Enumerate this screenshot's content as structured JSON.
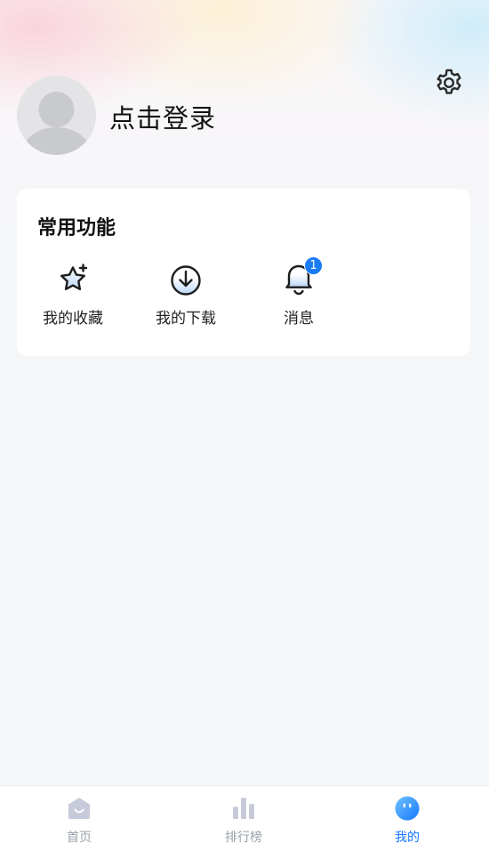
{
  "header": {
    "login_text": "点击登录",
    "settings_icon": "gear-icon",
    "avatar_icon": "default-avatar-icon"
  },
  "functions_card": {
    "title": "常用功能",
    "items": [
      {
        "label": "我的收藏",
        "icon": "star-sparkle-icon"
      },
      {
        "label": "我的下载",
        "icon": "download-circle-icon"
      },
      {
        "label": "消息",
        "icon": "bell-icon",
        "badge": "1"
      }
    ]
  },
  "tabbar": {
    "items": [
      {
        "label": "首页",
        "icon": "home-icon",
        "active": false
      },
      {
        "label": "排行榜",
        "icon": "bar-chart-icon",
        "active": false
      },
      {
        "label": "我的",
        "icon": "profile-face-icon",
        "active": true
      }
    ]
  },
  "colors": {
    "accent": "#1677ff",
    "badge": "#1a7cf5",
    "tab_inactive": "#9aa0aa",
    "background": "#f5f6f8"
  }
}
